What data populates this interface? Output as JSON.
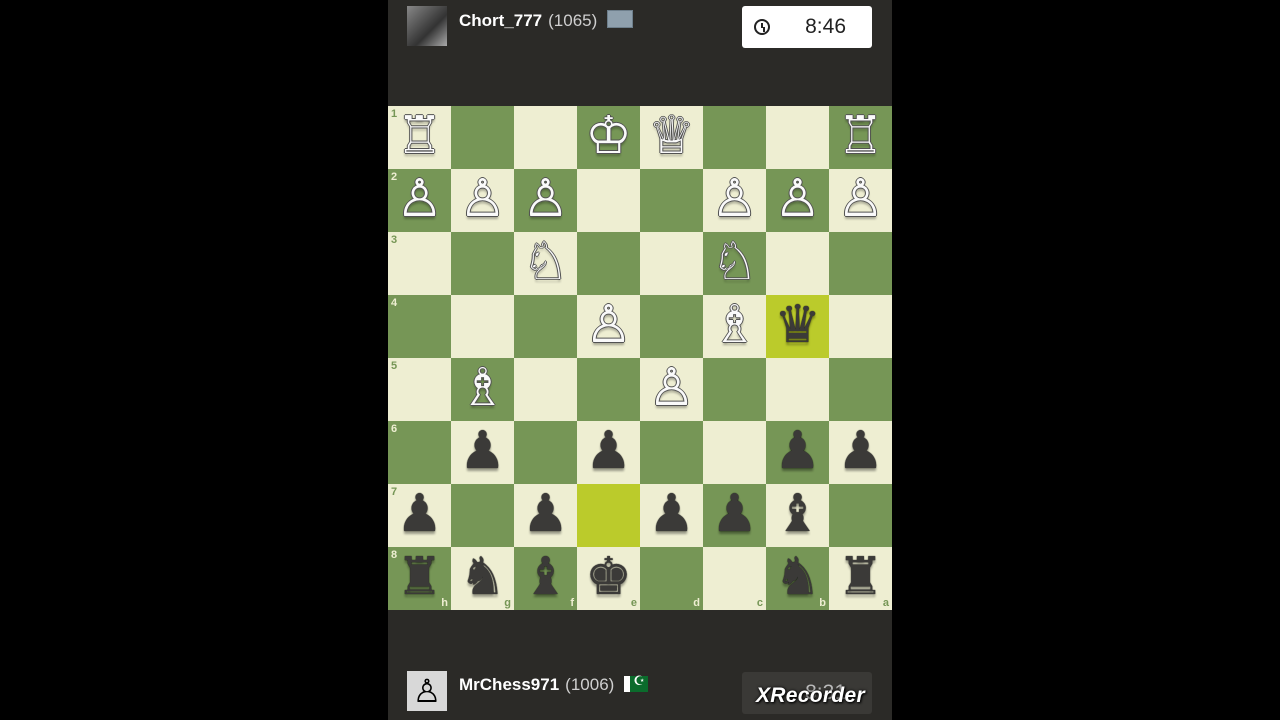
{
  "top_player": {
    "name": "Chort_777",
    "rating": "(1065)",
    "clock": "8:46",
    "avatar_icon": "player-photo"
  },
  "bottom_player": {
    "name": "MrChess971",
    "rating": "(1006)",
    "clock": "8:31",
    "avatar_icon": "pawn-avatar-icon",
    "avatar_glyph": "♙"
  },
  "watermark": "XRecorder",
  "colors": {
    "light_square": "#eeeed2",
    "dark_square": "#769656",
    "highlight_light": "#f7f769",
    "highlight_dark": "#bbcb2b"
  },
  "board": {
    "orientation": "black-bottom",
    "ranks_top_to_bottom": [
      "1",
      "2",
      "3",
      "4",
      "5",
      "6",
      "7",
      "8"
    ],
    "files_left_to_right": [
      "h",
      "g",
      "f",
      "e",
      "d",
      "c",
      "b",
      "a"
    ],
    "rows": [
      [
        "♖",
        "",
        "",
        "♔",
        "♕",
        "",
        "",
        "♖"
      ],
      [
        "♙",
        "♙",
        "♙",
        "",
        "",
        "♙",
        "♙",
        "♙"
      ],
      [
        "",
        "",
        "♘",
        "",
        "",
        "♘",
        "",
        ""
      ],
      [
        "",
        "",
        "",
        "♙",
        "",
        "♗",
        "♛",
        ""
      ],
      [
        "",
        "♗",
        "",
        "",
        "♙",
        "",
        "",
        ""
      ],
      [
        "",
        "♟",
        "",
        "♟",
        "",
        "",
        "♟",
        "♟"
      ],
      [
        "♟",
        "",
        "♟",
        "",
        "♟",
        "♟",
        "♝",
        ""
      ],
      [
        "♜",
        "♞",
        "♝",
        "♚",
        "",
        "",
        "♞",
        "♜"
      ]
    ],
    "highlights": [
      "b4",
      "e7"
    ]
  }
}
